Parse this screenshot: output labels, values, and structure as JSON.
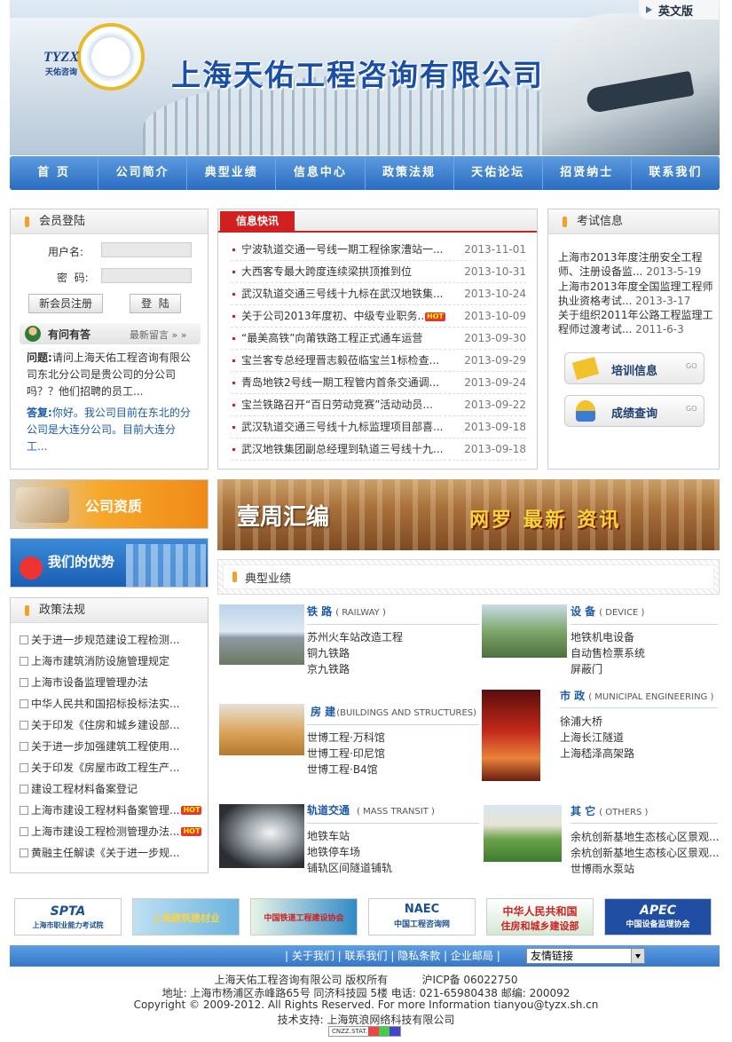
{
  "header": {
    "lang_link": "英文版",
    "logo_letters": "TYZX",
    "logo_cn": "天佑咨询",
    "company_name": "上海天佑工程咨询有限公司"
  },
  "nav": [
    "首 页",
    "公司简介",
    "典型业绩",
    "信息中心",
    "政策法规",
    "天佑论坛",
    "招贤纳士",
    "联系我们"
  ],
  "login": {
    "title": "会员登陆",
    "username_label": "用户名:",
    "password_label": "密  码:",
    "register_button": "新会员注册",
    "login_button": "登  陆"
  },
  "qa": {
    "title": "有问有答",
    "more": "最新留言 » »",
    "question_label": "问题:",
    "question": "请问上海天佑工程咨询有限公司东北分公司是贵公司的分公司吗？？他们招聘的员工...",
    "answer_label": "答复:",
    "answer": "你好。我公司目前在东北的分公司是大连分公司。目前大连分工..."
  },
  "news": {
    "title": "信息快讯",
    "hot": "HOT",
    "items": [
      {
        "text": "宁波轨道交通一号线一期工程徐家漕站一...",
        "date": "2013-11-01",
        "hot": false
      },
      {
        "text": "大西客专最大跨度连续梁拱顶推到位",
        "date": "2013-10-31",
        "hot": false
      },
      {
        "text": "武汉轨道交通三号线十九标在武汉地铁集...",
        "date": "2013-10-24",
        "hot": false
      },
      {
        "text": "关于公司2013年度初、中级专业职务...",
        "date": "2013-10-09",
        "hot": true
      },
      {
        "text": "“最美高铁”向莆铁路工程正式通车运营",
        "date": "2013-09-30",
        "hot": false
      },
      {
        "text": "宝兰客专总经理晋志毅莅临宝兰1标检查...",
        "date": "2013-09-29",
        "hot": false
      },
      {
        "text": "青岛地铁2号线一期工程管内首条交通调...",
        "date": "2013-09-24",
        "hot": false
      },
      {
        "text": "宝兰铁路召开“百日劳动竞赛”活动动员...",
        "date": "2013-09-22",
        "hot": false
      },
      {
        "text": "武汉轨道交通三号线十九标监理项目部喜...",
        "date": "2013-09-18",
        "hot": false
      },
      {
        "text": "武汉地铁集团副总经理到轨道三号线十九...",
        "date": "2013-09-18",
        "hot": false
      }
    ]
  },
  "exam": {
    "title": "考试信息",
    "items": [
      {
        "text": "上海市2013年度注册安全工程师、注册设备监...",
        "date": "2013-5-19"
      },
      {
        "text": "上海市2013年度全国监理工程师执业资格考试...",
        "date": "2013-3-17"
      },
      {
        "text": "关于组织2011年公路工程监理工程师过渡考试...",
        "date": "2011-6-3"
      }
    ],
    "training_button": "培训信息",
    "score_button": "成绩查询",
    "go": "GO"
  },
  "banners": {
    "qualification": "公司资质",
    "advantages": "我们的优势",
    "weekly_left": "壹周汇编",
    "weekly_right": "网罗 最新 资讯"
  },
  "policy": {
    "title": "政策法规",
    "items": [
      {
        "text": "关于进一步规范建设工程检测...",
        "hot": false
      },
      {
        "text": "上海市建筑消防设施管理规定",
        "hot": false
      },
      {
        "text": "上海市设备监理管理办法",
        "hot": false
      },
      {
        "text": "中华人民共和国招标投标法实...",
        "hot": false
      },
      {
        "text": "关于印发《住房和城乡建设部...",
        "hot": false
      },
      {
        "text": "关于进一步加强建筑工程使用...",
        "hot": false
      },
      {
        "text": "关于印发《房屋市政工程生产...",
        "hot": false
      },
      {
        "text": "建设工程材料备案登记",
        "hot": false
      },
      {
        "text": "上海市建设工程材料备案管理...",
        "hot": true
      },
      {
        "text": "上海市建设工程检测管理办法...",
        "hot": true
      },
      {
        "text": "黄融主任解读《关于进一步规...",
        "hot": false
      }
    ]
  },
  "business": {
    "title": "典型业绩",
    "railway": {
      "title": "铁  路",
      "en": "( RAILWAY )",
      "items": [
        "苏州火车站改造工程",
        "铜九铁路",
        "京九铁路"
      ]
    },
    "device": {
      "title": "设  备",
      "en": "( DEVICE )",
      "items": [
        "地铁机电设备",
        "自动售检票系统",
        "屏蔽门"
      ]
    },
    "buildings": {
      "title": "房  建",
      "en": "(BUILDINGS AND STRUCTURES)",
      "items": [
        "世博工程·万科馆",
        "世博工程·印尼馆",
        "世博工程·B4馆"
      ]
    },
    "municipal": {
      "title": "市  政",
      "en": "( MUNICIPAL ENGINEERING )",
      "items": [
        "徐浦大桥",
        "上海长江隧道",
        "上海嵇泽高架路"
      ]
    },
    "transit": {
      "title": "轨道交通",
      "en": "( MASS TRANSIT )",
      "items": [
        "地铁车站",
        "地铁停车场",
        "铺轨区间隧道铺轨"
      ]
    },
    "others": {
      "title": "其  它",
      "en": "( OTHERS )",
      "items": [
        "余杭创新基地生态核心区景观...",
        "余杭创新基地生态核心区景观...",
        "世博雨水泵站"
      ]
    }
  },
  "partners": [
    {
      "name": "SPTA",
      "sub": "上海市职业能力考试院"
    },
    {
      "name": "上海建筑建材业",
      "sub": ""
    },
    {
      "name": "中国铁道工程建设协会",
      "sub": ""
    },
    {
      "name": "NAEC",
      "sub": "中国工程咨询网"
    },
    {
      "name": "中华人民共和国",
      "sub": "住房和城乡建设部"
    },
    {
      "name": "APEC",
      "sub": "中国设备监理协会"
    }
  ],
  "footer": {
    "links": "| 关于我们 | 联系我们 | 隐私条款 | 企业邮局 |",
    "friend_links": "友情链接",
    "line1": "上海天佑工程咨询有限公司 版权所有          沪ICP备 06022750",
    "line2": "地址: 上海市杨浦区赤峰路65号 同济科技园 5楼 电话: 021-65980438 邮编: 200092",
    "line3": "Copyright © 2009-2012. All Rights Reserved. For more Information tianyou@tyzx.sh.cn",
    "line4": "技术支持: 上海筑浪网络科技有限公司",
    "stat": "CNZZ.STAT."
  },
  "colors": {
    "nav": "#2a6cc0",
    "news_tab": "#d12020",
    "accent": "#f2a02c",
    "title_blue": "#1a4fa8"
  }
}
